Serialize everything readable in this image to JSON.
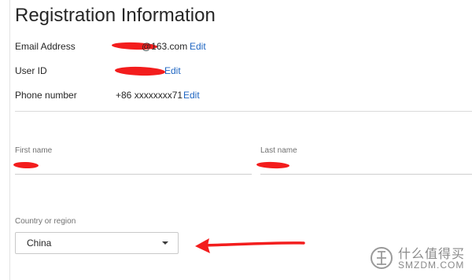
{
  "page": {
    "title": "Registration Information"
  },
  "account_info": {
    "email": {
      "label": "Email Address",
      "value": "@163.com",
      "edit_label": "Edit"
    },
    "user_id": {
      "label": "User ID",
      "value": "",
      "edit_label": "Edit"
    },
    "phone": {
      "label": "Phone number",
      "value": "+86 xxxxxxxx71",
      "edit_label": "Edit"
    }
  },
  "name_fields": {
    "first_name": {
      "label": "First name",
      "value": ""
    },
    "last_name": {
      "label": "Last name",
      "value": ""
    }
  },
  "country": {
    "label": "Country or region",
    "selected": "China"
  },
  "annotation": {
    "color": "#f31d1d"
  },
  "watermark": {
    "cn_text": "什么值得买",
    "en_text": "SMZDM.COM"
  },
  "colors": {
    "link": "#1f66c2",
    "redaction": "#f31d1d"
  }
}
